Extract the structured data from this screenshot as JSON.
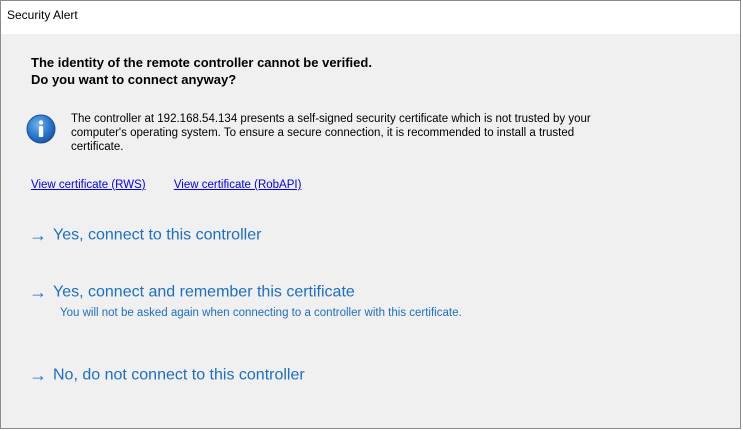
{
  "window": {
    "title": "Security Alert"
  },
  "heading": {
    "line1": "The identity of the remote controller cannot be verified.",
    "line2": "Do you want to connect anyway?"
  },
  "message": {
    "line1": "The controller at 192.168.54.134 presents a self-signed security certificate which is not trusted by your",
    "line2": "computer's operating system. To ensure a secure connection, it is recommended to install a trusted",
    "line3": "certificate."
  },
  "links": {
    "rws": "View certificate (RWS)",
    "robapi": "View certificate (RobAPI)"
  },
  "options": [
    {
      "arrow": "→",
      "label": "Yes, connect to this controller"
    },
    {
      "arrow": "→",
      "label": "Yes, connect and remember this certificate",
      "sub": "You will not be asked again when connecting to a controller with this certificate."
    },
    {
      "arrow": "→",
      "label": "No, do not connect to this controller"
    }
  ],
  "colors": {
    "accent": "#1c6fc4",
    "link": "#0000ee",
    "background": "#f0f0f0",
    "icon": "#1f6fc5"
  },
  "icons": {
    "info": "info-icon"
  }
}
